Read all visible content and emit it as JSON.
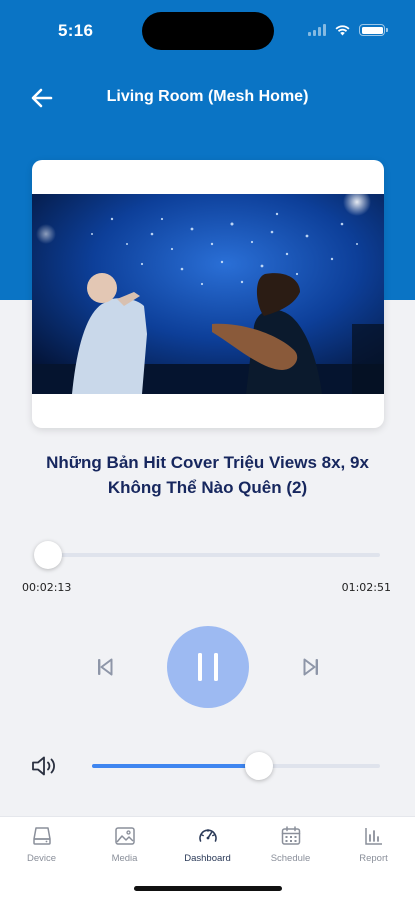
{
  "status_bar": {
    "time": "5:16",
    "icons": [
      "signal-icon",
      "wifi-icon",
      "battery-icon"
    ]
  },
  "header": {
    "title": "Living Room (Mesh Home)",
    "back_icon": "arrow-left-icon"
  },
  "player": {
    "title": "Những Bản Hit Cover Triệu Views 8x, 9x Không Thể Nào Quên (2)",
    "elapsed": "00:02:13",
    "total": "01:02:51",
    "progress_fraction": 0.035,
    "volume_fraction": 0.58,
    "controls": [
      "previous-icon",
      "pause-icon",
      "next-icon"
    ]
  },
  "tabs": [
    {
      "label": "Device",
      "icon": "device-icon",
      "active": false
    },
    {
      "label": "Media",
      "icon": "image-icon",
      "active": false
    },
    {
      "label": "Dashboard",
      "icon": "gauge-icon",
      "active": true
    },
    {
      "label": "Schedule",
      "icon": "calendar-icon",
      "active": false
    },
    {
      "label": "Report",
      "icon": "bar-chart-icon",
      "active": false
    }
  ],
  "colors": {
    "header_blue": "#0a74c5",
    "title_navy": "#17275e",
    "accent_blue": "#3f86f0",
    "play_button": "#9dbaf2"
  }
}
